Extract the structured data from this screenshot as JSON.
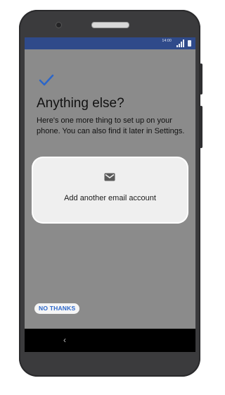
{
  "status_bar": {
    "time": "14:00"
  },
  "setup": {
    "title": "Anything else?",
    "description": "Here's one more thing to set up on your phone. You can also find it later in Settings.",
    "option_label": "Add another email account",
    "skip_label": "NO THANKS"
  },
  "icons": {
    "check": "checkmark-icon",
    "option": "mail-icon",
    "back": "back-icon"
  },
  "colors": {
    "status_bar": "#2f4a8a",
    "accent": "#2b66c9",
    "scrim": "#8b8b8b"
  }
}
